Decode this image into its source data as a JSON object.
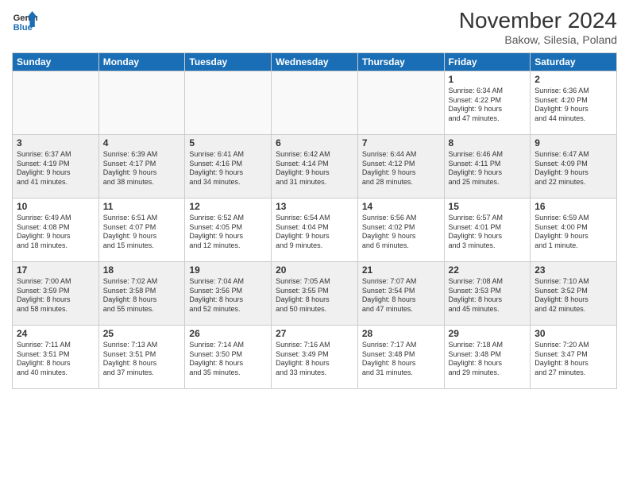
{
  "logo": {
    "text_general": "General",
    "text_blue": "Blue"
  },
  "header": {
    "month_title": "November 2024",
    "location": "Bakow, Silesia, Poland"
  },
  "weekdays": [
    "Sunday",
    "Monday",
    "Tuesday",
    "Wednesday",
    "Thursday",
    "Friday",
    "Saturday"
  ],
  "weeks": [
    [
      {
        "day": "",
        "info": ""
      },
      {
        "day": "",
        "info": ""
      },
      {
        "day": "",
        "info": ""
      },
      {
        "day": "",
        "info": ""
      },
      {
        "day": "",
        "info": ""
      },
      {
        "day": "1",
        "info": "Sunrise: 6:34 AM\nSunset: 4:22 PM\nDaylight: 9 hours\nand 47 minutes."
      },
      {
        "day": "2",
        "info": "Sunrise: 6:36 AM\nSunset: 4:20 PM\nDaylight: 9 hours\nand 44 minutes."
      }
    ],
    [
      {
        "day": "3",
        "info": "Sunrise: 6:37 AM\nSunset: 4:19 PM\nDaylight: 9 hours\nand 41 minutes."
      },
      {
        "day": "4",
        "info": "Sunrise: 6:39 AM\nSunset: 4:17 PM\nDaylight: 9 hours\nand 38 minutes."
      },
      {
        "day": "5",
        "info": "Sunrise: 6:41 AM\nSunset: 4:16 PM\nDaylight: 9 hours\nand 34 minutes."
      },
      {
        "day": "6",
        "info": "Sunrise: 6:42 AM\nSunset: 4:14 PM\nDaylight: 9 hours\nand 31 minutes."
      },
      {
        "day": "7",
        "info": "Sunrise: 6:44 AM\nSunset: 4:12 PM\nDaylight: 9 hours\nand 28 minutes."
      },
      {
        "day": "8",
        "info": "Sunrise: 6:46 AM\nSunset: 4:11 PM\nDaylight: 9 hours\nand 25 minutes."
      },
      {
        "day": "9",
        "info": "Sunrise: 6:47 AM\nSunset: 4:09 PM\nDaylight: 9 hours\nand 22 minutes."
      }
    ],
    [
      {
        "day": "10",
        "info": "Sunrise: 6:49 AM\nSunset: 4:08 PM\nDaylight: 9 hours\nand 18 minutes."
      },
      {
        "day": "11",
        "info": "Sunrise: 6:51 AM\nSunset: 4:07 PM\nDaylight: 9 hours\nand 15 minutes."
      },
      {
        "day": "12",
        "info": "Sunrise: 6:52 AM\nSunset: 4:05 PM\nDaylight: 9 hours\nand 12 minutes."
      },
      {
        "day": "13",
        "info": "Sunrise: 6:54 AM\nSunset: 4:04 PM\nDaylight: 9 hours\nand 9 minutes."
      },
      {
        "day": "14",
        "info": "Sunrise: 6:56 AM\nSunset: 4:02 PM\nDaylight: 9 hours\nand 6 minutes."
      },
      {
        "day": "15",
        "info": "Sunrise: 6:57 AM\nSunset: 4:01 PM\nDaylight: 9 hours\nand 3 minutes."
      },
      {
        "day": "16",
        "info": "Sunrise: 6:59 AM\nSunset: 4:00 PM\nDaylight: 9 hours\nand 1 minute."
      }
    ],
    [
      {
        "day": "17",
        "info": "Sunrise: 7:00 AM\nSunset: 3:59 PM\nDaylight: 8 hours\nand 58 minutes."
      },
      {
        "day": "18",
        "info": "Sunrise: 7:02 AM\nSunset: 3:58 PM\nDaylight: 8 hours\nand 55 minutes."
      },
      {
        "day": "19",
        "info": "Sunrise: 7:04 AM\nSunset: 3:56 PM\nDaylight: 8 hours\nand 52 minutes."
      },
      {
        "day": "20",
        "info": "Sunrise: 7:05 AM\nSunset: 3:55 PM\nDaylight: 8 hours\nand 50 minutes."
      },
      {
        "day": "21",
        "info": "Sunrise: 7:07 AM\nSunset: 3:54 PM\nDaylight: 8 hours\nand 47 minutes."
      },
      {
        "day": "22",
        "info": "Sunrise: 7:08 AM\nSunset: 3:53 PM\nDaylight: 8 hours\nand 45 minutes."
      },
      {
        "day": "23",
        "info": "Sunrise: 7:10 AM\nSunset: 3:52 PM\nDaylight: 8 hours\nand 42 minutes."
      }
    ],
    [
      {
        "day": "24",
        "info": "Sunrise: 7:11 AM\nSunset: 3:51 PM\nDaylight: 8 hours\nand 40 minutes."
      },
      {
        "day": "25",
        "info": "Sunrise: 7:13 AM\nSunset: 3:51 PM\nDaylight: 8 hours\nand 37 minutes."
      },
      {
        "day": "26",
        "info": "Sunrise: 7:14 AM\nSunset: 3:50 PM\nDaylight: 8 hours\nand 35 minutes."
      },
      {
        "day": "27",
        "info": "Sunrise: 7:16 AM\nSunset: 3:49 PM\nDaylight: 8 hours\nand 33 minutes."
      },
      {
        "day": "28",
        "info": "Sunrise: 7:17 AM\nSunset: 3:48 PM\nDaylight: 8 hours\nand 31 minutes."
      },
      {
        "day": "29",
        "info": "Sunrise: 7:18 AM\nSunset: 3:48 PM\nDaylight: 8 hours\nand 29 minutes."
      },
      {
        "day": "30",
        "info": "Sunrise: 7:20 AM\nSunset: 3:47 PM\nDaylight: 8 hours\nand 27 minutes."
      }
    ]
  ]
}
